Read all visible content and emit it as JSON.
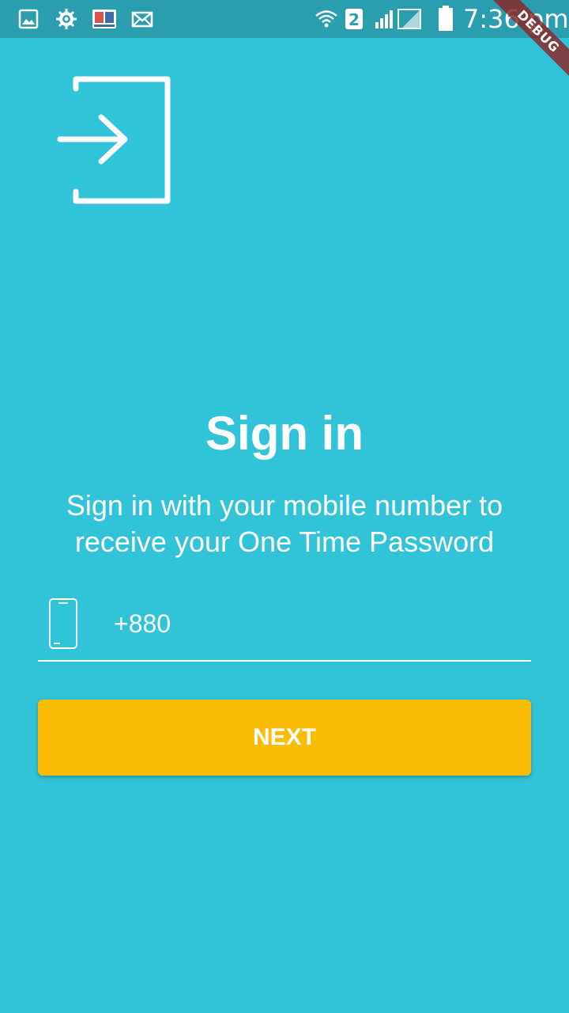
{
  "status_bar": {
    "time": "7:36 pm",
    "sim_slot": "2",
    "icons": [
      "gallery-icon",
      "settings-gear-icon",
      "dictionary-app-icon",
      "mail-icon",
      "wifi-icon",
      "sim-2-icon",
      "signal-icon",
      "battery-icon"
    ]
  },
  "debug_banner": {
    "label": "DEBUG"
  },
  "header": {
    "icon": "login-icon"
  },
  "main": {
    "title": "Sign in",
    "subtitle": "Sign in with your mobile number to receive your One Time Password",
    "phone_field": {
      "icon": "phone-icon",
      "value": "+880",
      "placeholder": ""
    },
    "next_button_label": "NEXT"
  },
  "colors": {
    "background": "#31C3D7",
    "status_bar": "#2A9DAE",
    "button": "#FBBC05",
    "text": "#FFFFFF",
    "debug_ribbon": "#8C2424"
  }
}
